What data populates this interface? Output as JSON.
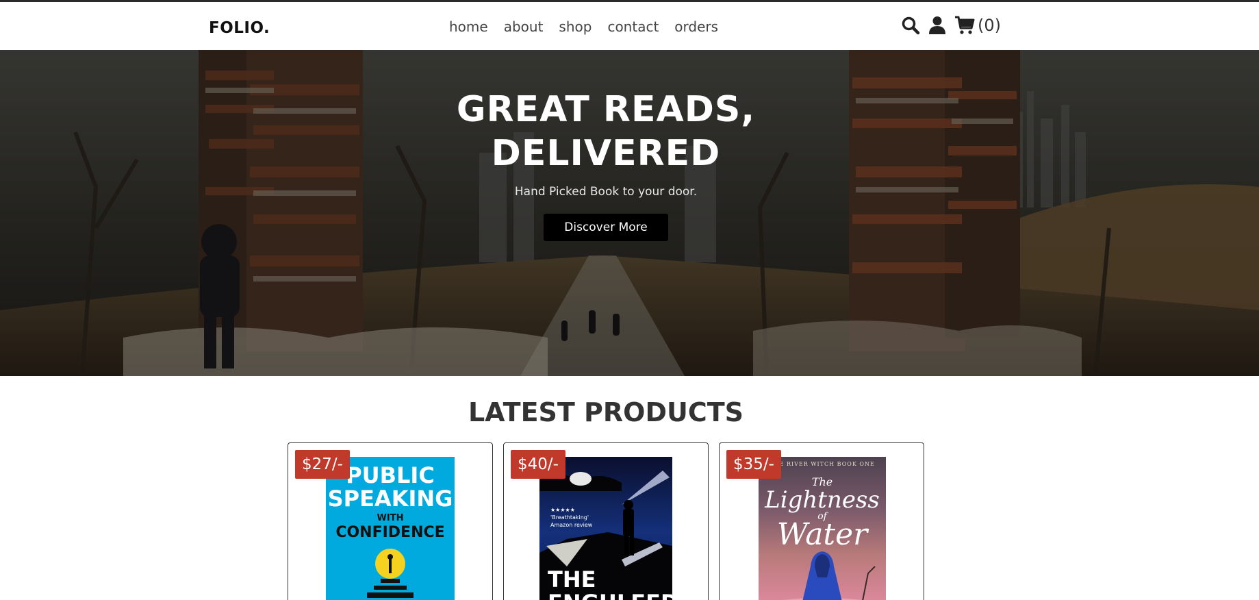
{
  "header": {
    "logo": "FOLIO.",
    "nav": [
      "home",
      "about",
      "shop",
      "contact",
      "orders"
    ],
    "cart_count": "(0)",
    "icons": [
      "search-icon",
      "user-icon",
      "cart-icon"
    ]
  },
  "hero": {
    "title_line1": "GREAT READS,",
    "title_line2": "DELIVERED",
    "subtitle": "Hand Picked Book to your door.",
    "button_label": "Discover More"
  },
  "products": {
    "title": "LATEST PRODUCTS",
    "items": [
      {
        "price": "$27/-",
        "cover_lines": [
          "PUBLIC",
          "SPEAKING",
          "WITH",
          "CONFIDENCE"
        ],
        "cover_color": "#00aadf"
      },
      {
        "price": "$40/-",
        "cover_lines": [
          "★★★★★",
          "'Breathtaking'",
          "Amazon review",
          "THE",
          "ENGULFED"
        ],
        "cover_color": "#0b1d5a"
      },
      {
        "price": "$35/-",
        "cover_lines": [
          "THE RIVER WITCH BOOK ONE",
          "The",
          "Lightness",
          "of",
          "Water"
        ],
        "cover_color": "#7a5a6a"
      }
    ]
  },
  "colors": {
    "accent": "#c0392b",
    "button": "#000000"
  }
}
